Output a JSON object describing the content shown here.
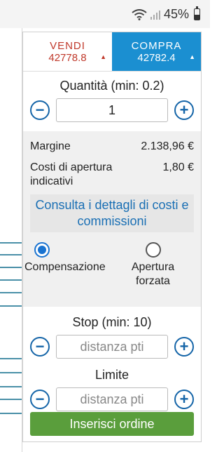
{
  "status_bar": {
    "battery": "45%",
    "battery_level": 0.45
  },
  "trade": {
    "sell_label": "VENDI",
    "sell_price": "42778.8",
    "buy_label": "COMPRA",
    "buy_price": "42782.4",
    "sell_color": "#c0392b",
    "buy_color": "#1b8fd1"
  },
  "quantity": {
    "title": "Quantità (min: 0.2)",
    "value": "1"
  },
  "info": {
    "margin_label": "Margine",
    "margin_value": "2.138,96 €",
    "costs_label": "Costi di apertura indicativi",
    "costs_value": "1,80 €",
    "details_link": "Consulta i dettagli di costi e commissioni"
  },
  "mode": {
    "option1": "Compensazione",
    "option2": "Apertura forzata",
    "selected": "Compensazione"
  },
  "stop": {
    "title": "Stop (min: 10)",
    "placeholder": "distanza pti"
  },
  "limit": {
    "title": "Limite",
    "placeholder": "distanza pti"
  },
  "order_button": "Inserisci ordine",
  "icons": [
    "wifi-icon",
    "signal-icon",
    "battery-icon",
    "minus-icon",
    "plus-icon",
    "arrow-up-icon"
  ]
}
